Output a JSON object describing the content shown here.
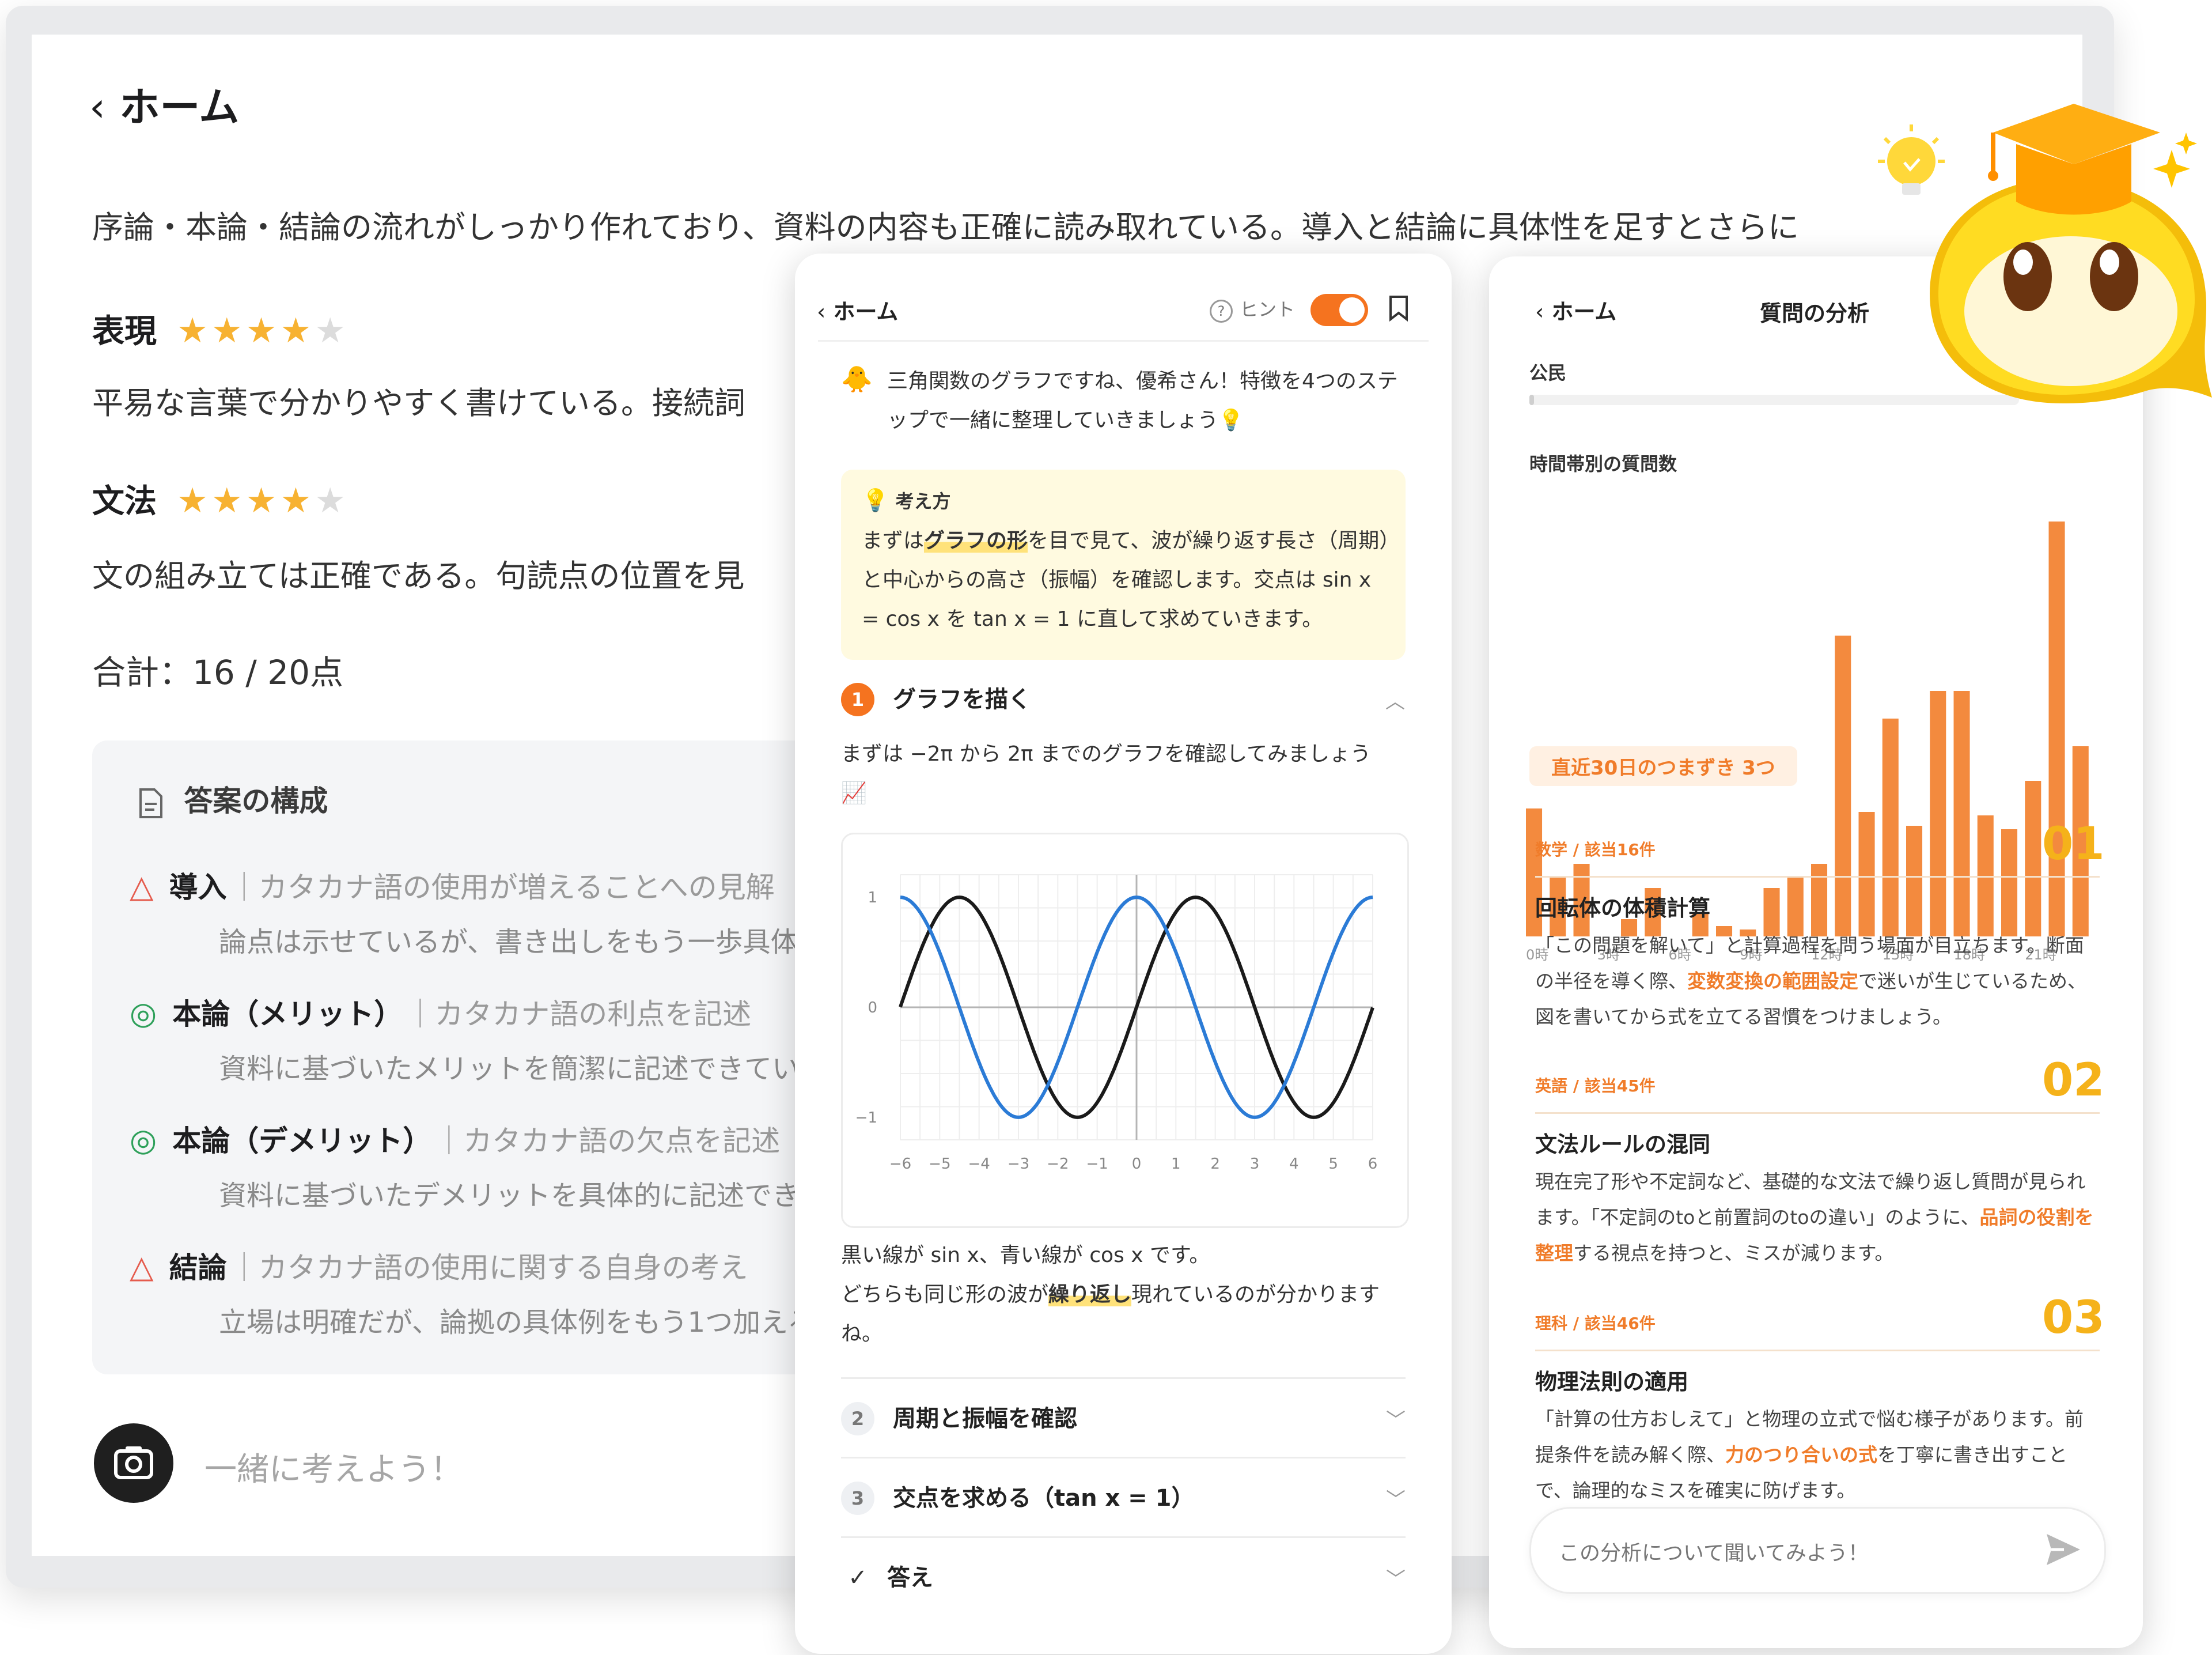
{
  "back_card": {
    "nav_title": "ホーム",
    "summary": "序論・本論・結論の流れがしっかり作れており、資料の内容も正確に読み取れている。導入と結論に具体性を足すとさらに",
    "criteria": [
      {
        "name": "表現",
        "rating": 4,
        "max": 5,
        "comment": "平易な言葉で分かりやすく書けている。接続詞"
      },
      {
        "name": "文法",
        "rating": 4,
        "max": 5,
        "comment": "文の組み立ては正確である。句読点の位置を見"
      }
    ],
    "total": "合計：16 / 20点",
    "structure": {
      "title": "答案の構成",
      "rows": [
        {
          "mark": "△",
          "title": "導入",
          "subtitle": "カタカナ語の使用が増えることへの見解",
          "desc": "論点は示せているが、書き出しをもう一歩具体的"
        },
        {
          "mark": "◎",
          "title": "本論（メリット）",
          "subtitle": "カタカナ語の利点を記述",
          "desc": "資料に基づいたメリットを簡潔に記述できている"
        },
        {
          "mark": "◎",
          "title": "本論（デメリット）",
          "subtitle": "カタカナ語の欠点を記述",
          "desc": "資料に基づいたデメリットを具体的に記述できて"
        },
        {
          "mark": "△",
          "title": "結論",
          "subtitle": "カタカナ語の使用に関する自身の考え",
          "desc": "立場は明確だが、論拠の具体例をもう1つ加えると"
        }
      ]
    },
    "chat_placeholder": "一緒に考えよう！"
  },
  "mid_phone": {
    "nav_title": "ホーム",
    "hint_label": "ヒント",
    "hint_enabled": true,
    "intro": "三角関数のグラフですね、優希さん！特徴を4つのステップで一緒に整理していきましょう💡",
    "tip": {
      "title": "考え方",
      "line1_pre": "まずは",
      "line1_hl": "グラフの形",
      "line1_post": "を目で見て、波が繰り返す長さ（周期）と中心からの高さ（振幅）を確認します。交点は sin x = cos x を tan x = 1 に直して求めていきます。"
    },
    "step1": {
      "num": "1",
      "label": "グラフを描く",
      "text": "まずは −2π から 2π までのグラフを確認してみましょう",
      "emoji": "📈",
      "caption1": "黒い線が sin x、青い線が cos x です。",
      "caption2_pre": "どちらも同じ形の波が",
      "caption2_hl": "繰り返し",
      "caption2_post": "現れているのが分かりますね。"
    },
    "steps": [
      {
        "num": "2",
        "label": "周期と振幅を確認"
      },
      {
        "num": "3",
        "label": "交点を求める（tan x = 1）"
      },
      {
        "num": "✓",
        "label": "答え"
      }
    ]
  },
  "chart_data": {
    "type": "line",
    "x_ticks": [
      "−6",
      "−5",
      "−4",
      "−3",
      "−2",
      "−1",
      "0",
      "1",
      "2",
      "3",
      "4",
      "5",
      "6"
    ],
    "y_ticks": [
      "1",
      "0",
      "−1"
    ],
    "xlim": [
      -6.28,
      6.28
    ],
    "ylim": [
      -1,
      1
    ],
    "grid": true,
    "series": [
      {
        "name": "sin x",
        "function": "sin",
        "color": "#1a1a1a"
      },
      {
        "name": "cos x",
        "function": "cos",
        "color": "#2b7bd6"
      }
    ]
  },
  "hist_chart": {
    "type": "bar",
    "title": "時間帯別の質問数",
    "x_tick_labels": [
      "0時",
      "3時",
      "6時",
      "9時",
      "12時",
      "15時",
      "18時",
      "21時"
    ],
    "categories": [
      "0",
      "1",
      "2",
      "3",
      "4",
      "5",
      "6",
      "7",
      "8",
      "9",
      "10",
      "11",
      "12",
      "13",
      "14",
      "15",
      "16",
      "17",
      "18",
      "19",
      "20",
      "21",
      "22",
      "23"
    ],
    "values": [
      37,
      17,
      21,
      0,
      5,
      14,
      0,
      7,
      3,
      2,
      14,
      17,
      21,
      87,
      36,
      63,
      32,
      71,
      71,
      35,
      31,
      45,
      120,
      55
    ],
    "color": "#f38a3e"
  },
  "right_phone": {
    "nav_title": "ホーム",
    "header_title": "質問の分析",
    "subject_label": "公民",
    "subject_progress": 0.0,
    "badge": "直近30日のつまずき 3つ",
    "items": [
      {
        "cat": "数学 / 該当16件",
        "rank": "01",
        "title": "回転体の体積計算",
        "pre": "「この問題を解いて」と計算過程を問う場面が目立ちます。断面の半径を導く際、",
        "hl": "変数変換の範囲設定",
        "post": "で迷いが生じているため、図を書いてから式を立てる習慣をつけましょう。"
      },
      {
        "cat": "英語 / 該当45件",
        "rank": "02",
        "title": "文法ルールの混同",
        "pre": "現在完了形や不定詞など、基礎的な文法で繰り返し質問が見られます。「不定詞のtoと前置詞のtoの違い」のように、",
        "hl": "品詞の役割を整理",
        "post": "する視点を持つと、ミスが減ります。"
      },
      {
        "cat": "理科 / 該当46件",
        "rank": "03",
        "title": "物理法則の適用",
        "pre": "「計算の仕方おしえて」と物理の立式で悩む様子があります。前提条件を読み解く際、",
        "hl": "力のつり合いの式",
        "post": "を丁寧に書き出すことで、論理的なミスを確実に防げます。"
      }
    ],
    "chat_placeholder": "この分析について聞いてみよう！"
  }
}
